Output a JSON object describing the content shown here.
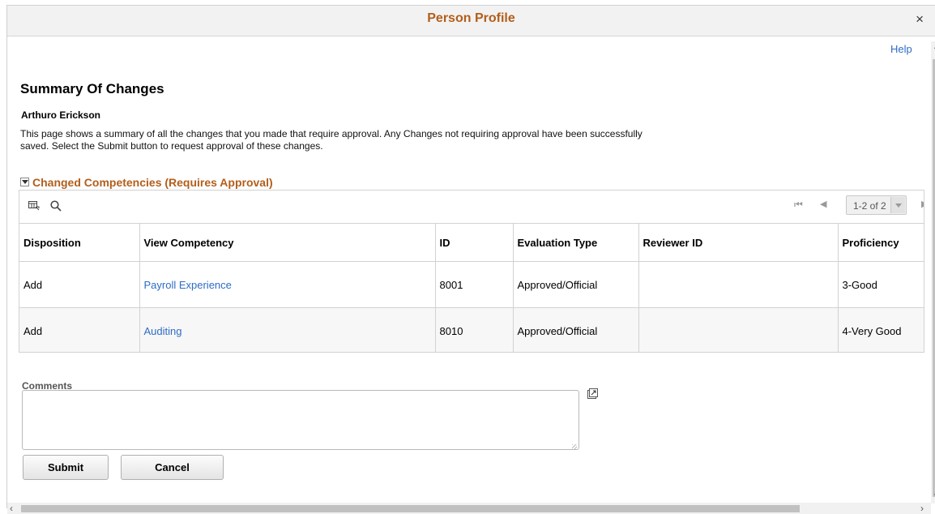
{
  "window": {
    "title": "Person Profile",
    "close_glyph": "×",
    "help_label": "Help"
  },
  "summary": {
    "heading": "Summary Of Changes",
    "person_name": "Arthuro Erickson",
    "instructions": "This page shows a summary of all the changes that you made that require approval. Any Changes not requiring approval have been successfully saved. Select the Submit button to request approval of these changes."
  },
  "section": {
    "title": "Changed Competencies (Requires Approval)"
  },
  "grid": {
    "toolbar_icons": [
      "personalize-grid-icon",
      "search-icon"
    ],
    "pager": {
      "first_glyph": "⏮",
      "prev_glyph": "◀",
      "range": "1-2 of 2",
      "next_glyph": "▶"
    },
    "columns": [
      "Disposition",
      "View Competency",
      "ID",
      "Evaluation Type",
      "Reviewer ID",
      "Proficiency"
    ],
    "rows": [
      {
        "disposition": "Add",
        "competency": "Payroll Experience",
        "id": "8001",
        "evaluation_type": "Approved/Official",
        "reviewer_id": "",
        "proficiency": "3-Good"
      },
      {
        "disposition": "Add",
        "competency": "Auditing",
        "id": "8010",
        "evaluation_type": "Approved/Official",
        "reviewer_id": "",
        "proficiency": "4-Very Good"
      }
    ]
  },
  "comments": {
    "label": "Comments",
    "value": ""
  },
  "buttons": {
    "submit": "Submit",
    "cancel": "Cancel"
  },
  "colors": {
    "title": "#b35e1b",
    "link": "#2e6cc5"
  }
}
